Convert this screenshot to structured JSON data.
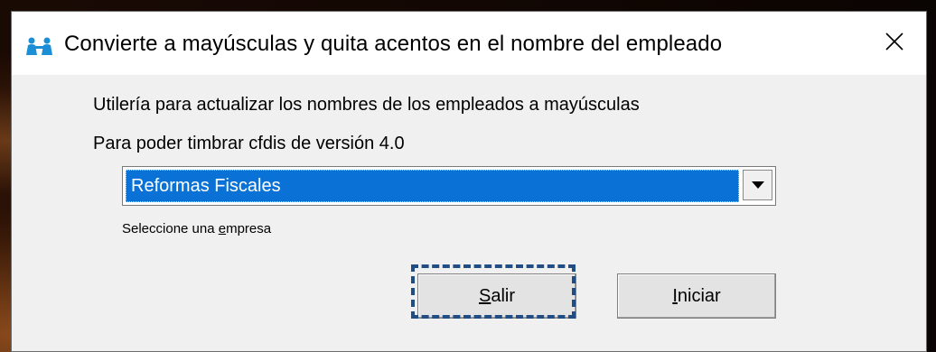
{
  "window": {
    "title": "Convierte a mayúsculas y quita acentos en el nombre del empleado",
    "close_glyph": "✕"
  },
  "body": {
    "line1": "Utilería para actualizar los nombres de los empleados a mayúsculas",
    "line2": "Para poder timbrar cfdis de versión 4.0"
  },
  "company_select": {
    "value": "Reformas Fiscales"
  },
  "hint": {
    "before": "Seleccione una ",
    "mnemonic": "e",
    "after": "mpresa"
  },
  "buttons": {
    "salir": {
      "mnemonic": "S",
      "rest": "alir"
    },
    "iniciar": {
      "mnemonic": "I",
      "rest": "niciar"
    }
  },
  "colors": {
    "selection": "#0a72d6",
    "focus_ring": "#1f4d84",
    "icon": "#1a8fd6"
  }
}
